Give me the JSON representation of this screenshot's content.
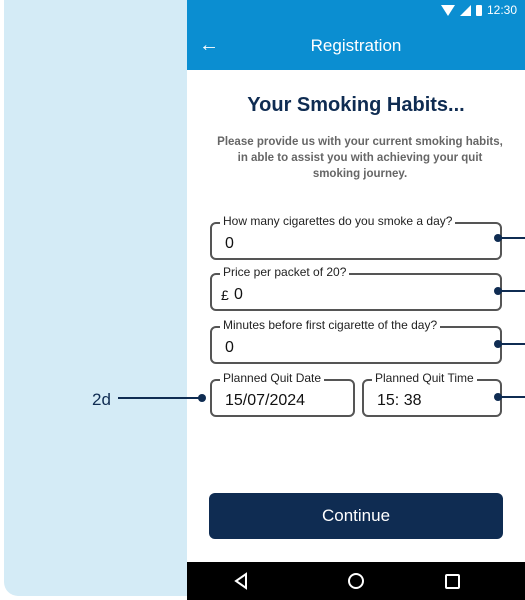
{
  "status_bar": {
    "time": "12:30"
  },
  "app_bar": {
    "title": "Registration"
  },
  "screen": {
    "heading": "Your Smoking Habits...",
    "intro": "Please provide us with your current smoking habits, in able to assist you with achieving your quit smoking journey."
  },
  "fields": {
    "cigarettes": {
      "label": "How many cigarettes do you smoke a day?",
      "value": "0"
    },
    "price": {
      "label": "Price per packet of 20?",
      "prefix": "£",
      "value": "0"
    },
    "minutes": {
      "label": "Minutes before first cigarette of the day?",
      "value": "0"
    },
    "quit_date": {
      "label": "Planned Quit Date",
      "value": "15/07/2024"
    },
    "quit_time": {
      "label": "Planned Quit Time",
      "value": "15: 38"
    }
  },
  "continue_label": "Continue",
  "annotation": {
    "label": "2d"
  },
  "colors": {
    "app_bar": "#0b8ed1",
    "navy": "#0f2c52",
    "backdrop": "#d4ebf6"
  },
  "icons": [
    "wifi-icon",
    "signal-icon",
    "battery-icon",
    "back-arrow-icon",
    "nav-back-icon",
    "nav-home-icon",
    "nav-recent-icon"
  ]
}
